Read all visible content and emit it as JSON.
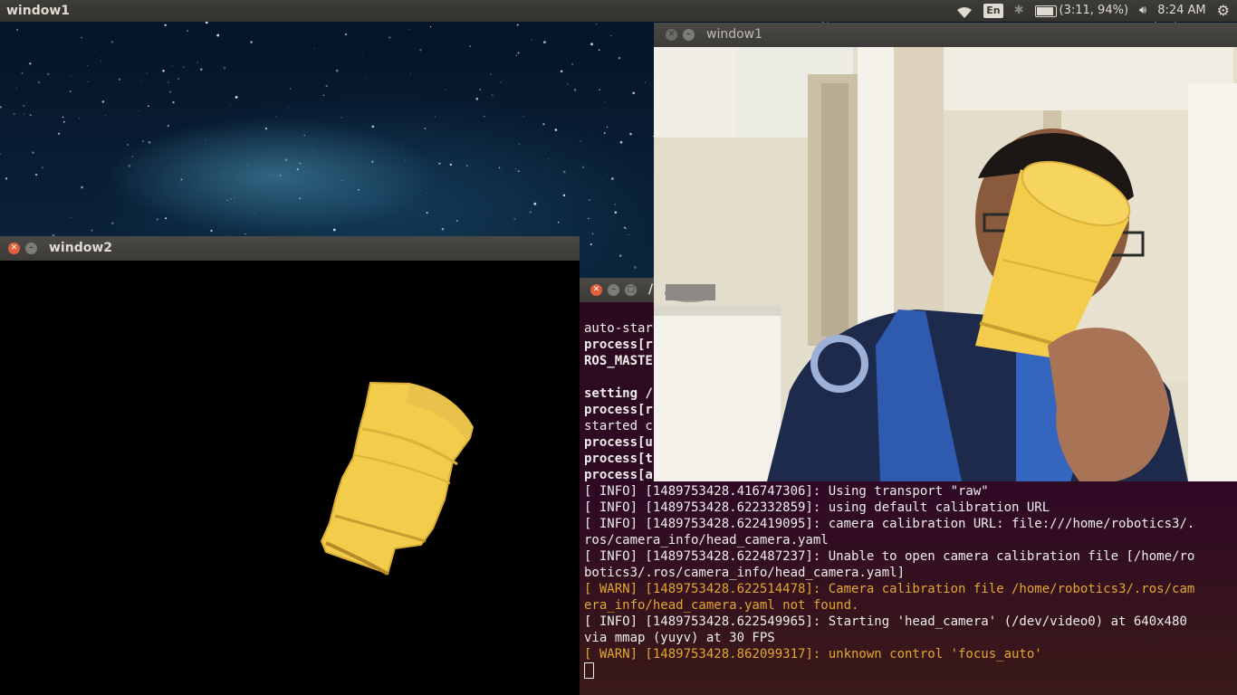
{
  "panel": {
    "title": "window1",
    "keyboard_layout": "En",
    "battery": "(3:11, 94%)",
    "time": "8:24 AM"
  },
  "window2": {
    "title": "window2"
  },
  "window1": {
    "title": "window1"
  },
  "terminal": {
    "title": "/",
    "partial_lines": [
      {
        "text": "auto-star",
        "style": "normal"
      },
      {
        "text": "process[r",
        "style": "bold"
      },
      {
        "text": "ROS_MASTE",
        "style": "bold"
      },
      {
        "text": "",
        "style": "normal"
      },
      {
        "text": "setting /",
        "style": "bold"
      },
      {
        "text": "process[r",
        "style": "bold"
      },
      {
        "text": "started c",
        "style": "normal"
      },
      {
        "text": "process[u",
        "style": "bold"
      },
      {
        "text": "process[t",
        "style": "bold"
      },
      {
        "text": "process[a",
        "style": "bold"
      }
    ],
    "log_lines": [
      {
        "text": "[ INFO] [1489753428.416747306]: Using transport \"raw\"",
        "style": "info"
      },
      {
        "text": "[ INFO] [1489753428.622332859]: using default calibration URL",
        "style": "info"
      },
      {
        "text": "[ INFO] [1489753428.622419095]: camera calibration URL: file:///home/robotics3/.",
        "style": "info"
      },
      {
        "text": "ros/camera_info/head_camera.yaml",
        "style": "info"
      },
      {
        "text": "[ INFO] [1489753428.622487237]: Unable to open camera calibration file [/home/ro",
        "style": "info"
      },
      {
        "text": "botics3/.ros/camera_info/head_camera.yaml]",
        "style": "info"
      },
      {
        "text": "[ WARN] [1489753428.622514478]: Camera calibration file /home/robotics3/.ros/cam",
        "style": "warn"
      },
      {
        "text": "era_info/head_camera.yaml not found.",
        "style": "warn"
      },
      {
        "text": "[ INFO] [1489753428.622549965]: Starting 'head_camera' (/dev/video0) at 640x480",
        "style": "info"
      },
      {
        "text": "via mmap (yuyv) at 30 FPS",
        "style": "info"
      },
      {
        "text": "[ WARN] [1489753428.862099317]: unknown control 'focus_auto'",
        "style": "warn"
      }
    ]
  },
  "colors": {
    "accent_close": "#e2603a",
    "terminal_bg": "#300a24",
    "warn_text": "#e3a72f",
    "cup_yellow": "#f2cc4a"
  },
  "icons": {
    "wifi": "wifi-icon",
    "bluetooth": "bluetooth-icon",
    "battery": "battery-icon",
    "volume": "volume-icon",
    "settings": "gear-icon"
  }
}
